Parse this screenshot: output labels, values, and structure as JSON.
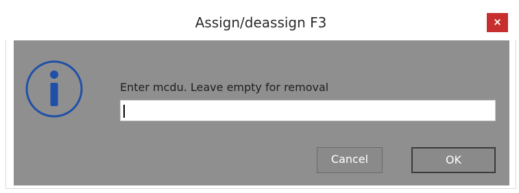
{
  "dialog": {
    "title": "Assign/deassign F3",
    "close_label": "×",
    "prompt": "Enter mcdu. Leave empty for removal",
    "input_value": "",
    "cancel_label": "Cancel",
    "ok_label": "OK"
  },
  "icons": {
    "info": "info-icon",
    "close": "close-icon"
  },
  "colors": {
    "client_background": "#8f8f8f",
    "close_button": "#c72f2f",
    "info_icon": "#1f4fa8"
  }
}
